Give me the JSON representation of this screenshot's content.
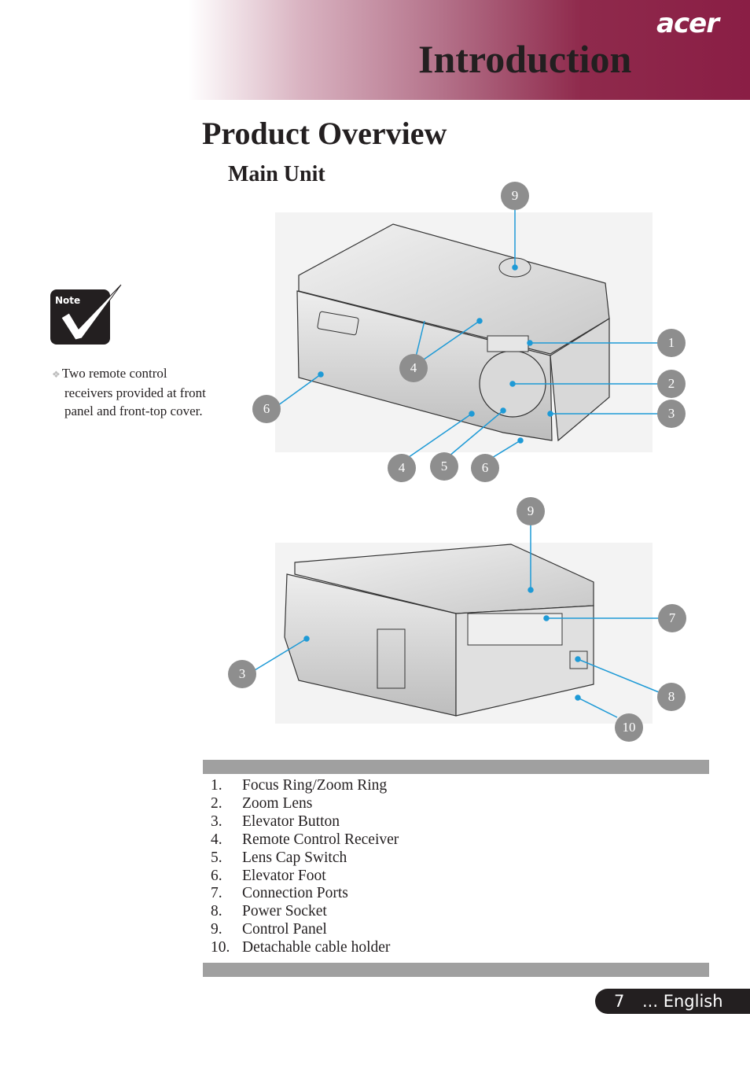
{
  "header": {
    "brand": "acer",
    "chapter_title": "Introduction",
    "colors": {
      "gradient_end": "#8a1e45",
      "gradient_start": "#ffffff"
    }
  },
  "section_title": "Product Overview",
  "subsection_title": "Main Unit",
  "note": {
    "icon_label": "Note",
    "bullet": "❖",
    "text": "Two remote control receivers provided at front panel and front-top cover."
  },
  "figures": {
    "front_view": {
      "callouts": [
        "9",
        "1",
        "2",
        "3",
        "4",
        "6",
        "4",
        "5",
        "6"
      ]
    },
    "rear_view": {
      "callouts": [
        "9",
        "7",
        "3",
        "8",
        "10"
      ]
    },
    "leader_color": "#1e9ad6",
    "callout_color": "#8e8e8e"
  },
  "parts_list": [
    {
      "num": "1.",
      "label": "Focus Ring/Zoom Ring"
    },
    {
      "num": "2.",
      "label": "Zoom Lens"
    },
    {
      "num": "3.",
      "label": "Elevator Button"
    },
    {
      "num": "4.",
      "label": "Remote Control Receiver"
    },
    {
      "num": "5.",
      "label": "Lens Cap Switch"
    },
    {
      "num": "6.",
      "label": "Elevator Foot"
    },
    {
      "num": "7.",
      "label": "Connection Ports"
    },
    {
      "num": "8.",
      "label": "Power Socket"
    },
    {
      "num": "9.",
      "label": "Control Panel"
    },
    {
      "num": "10.",
      "label": "Detachable cable holder"
    }
  ],
  "footer": {
    "page_number": "7",
    "language": "... English"
  }
}
